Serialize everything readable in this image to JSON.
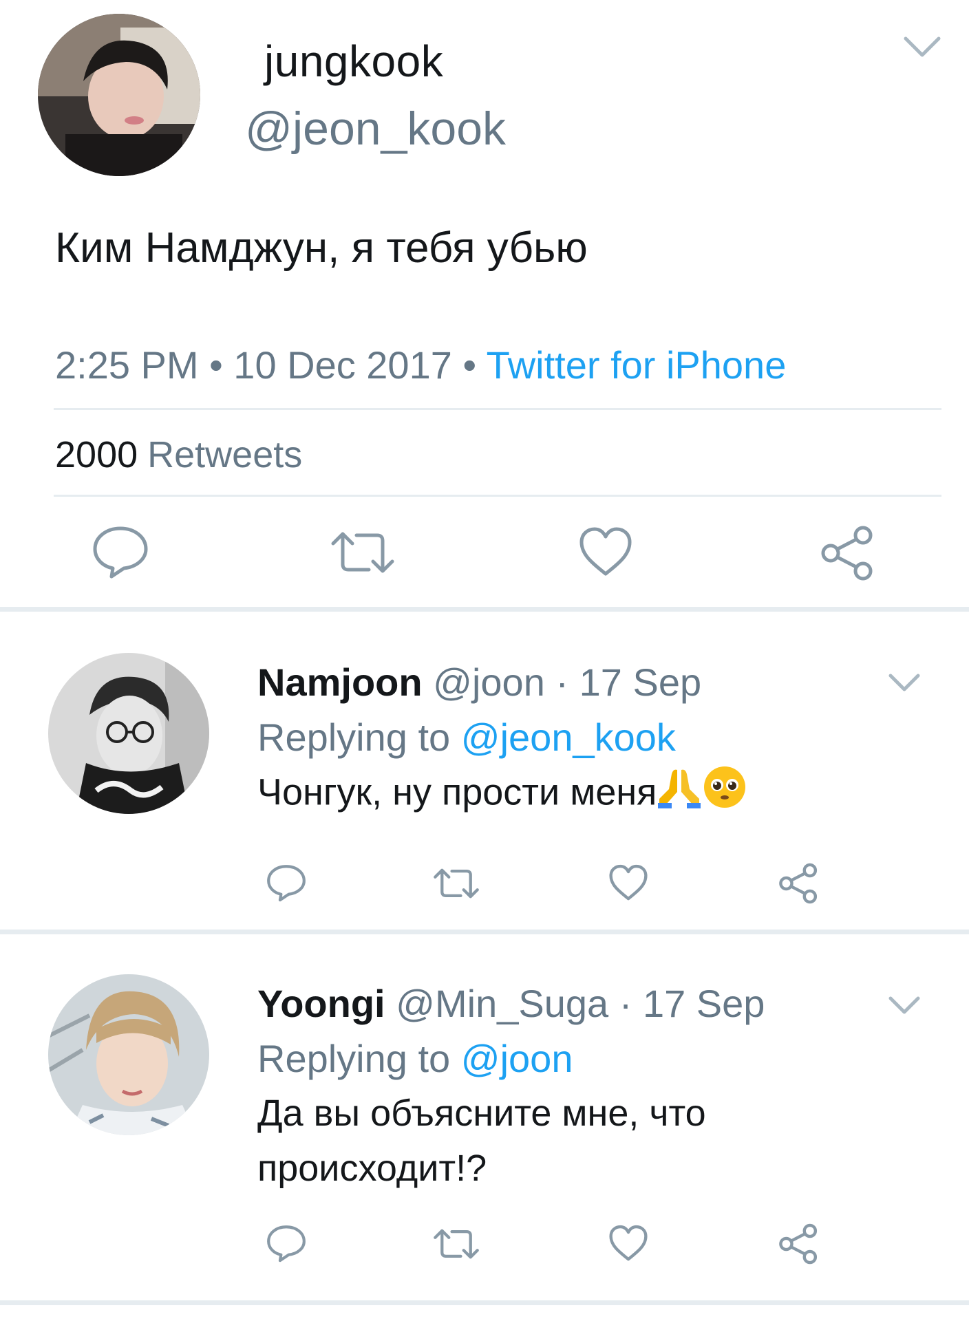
{
  "main_tweet": {
    "name": "jungkook",
    "handle": "@jeon_kook",
    "text": "Ким Намджун, я тебя убью",
    "time": "2:25 PM",
    "date": "10 Dec 2017",
    "source": "Twitter for iPhone",
    "retweet_count": "2000",
    "retweet_label": "Retweets"
  },
  "replies": [
    {
      "name": "Namjoon",
      "handle": "@joon",
      "date": "17 Sep",
      "replying_label": "Replying to",
      "replying_to": "@jeon_kook",
      "text": "Чонгук, ну прости меня",
      "emoji": [
        "folded-hands",
        "pleading-face"
      ]
    },
    {
      "name": "Yoongi",
      "handle": "@Min_Suga",
      "date": "17 Sep",
      "replying_label": "Replying to",
      "replying_to": "@joon",
      "text_line1": "Да вы объясните мне, что",
      "text_line2": "происходит!?"
    }
  ],
  "colors": {
    "accent": "#1da1f2",
    "secondary_text": "#657786",
    "primary_text": "#14171a",
    "divider": "#e6ecf0"
  },
  "icons": [
    "reply-icon",
    "retweet-icon",
    "like-icon",
    "share-icon",
    "chevron-down-icon"
  ]
}
